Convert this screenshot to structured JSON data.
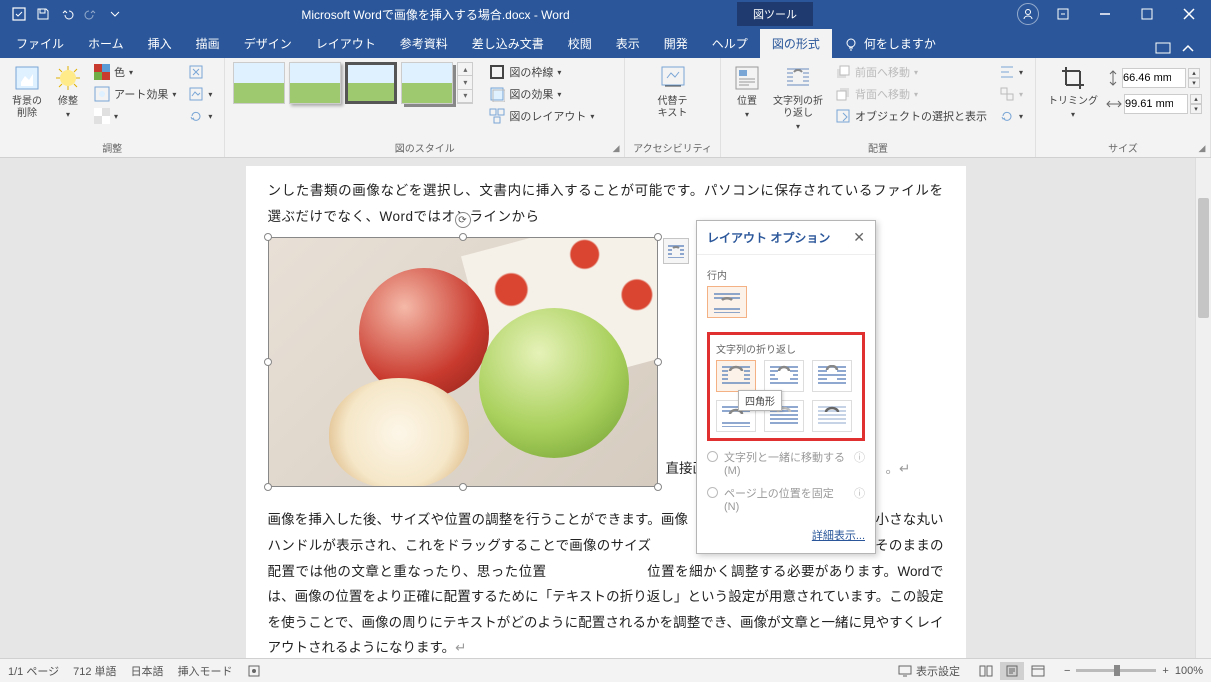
{
  "titlebar": {
    "doc_title": "Microsoft Wordで画像を挿入する場合.docx - Word",
    "context_tab": "図ツール"
  },
  "tabs": {
    "file": "ファイル",
    "home": "ホーム",
    "insert": "挿入",
    "draw": "描画",
    "design": "デザイン",
    "layout": "レイアウト",
    "references": "参考資料",
    "mailings": "差し込み文書",
    "review": "校閲",
    "view": "表示",
    "developer": "開発",
    "help": "ヘルプ",
    "format": "図の形式",
    "tell_me": "何をしますか"
  },
  "ribbon": {
    "remove_bg": "背景の\n削除",
    "corrections": "修整",
    "color": "色",
    "artistic": "アート効果",
    "adjust_group": "調整",
    "border": "図の枠線",
    "effects": "図の効果",
    "layout_pic": "図のレイアウト",
    "styles_group": "図のスタイル",
    "alt_text": "代替テ\nキスト",
    "access_group": "アクセシビリティ",
    "position": "位置",
    "wrap_text": "文字列の折\nり返し",
    "bring_fwd": "前面へ移動",
    "send_back": "背面へ移動",
    "selection": "オブジェクトの選択と表示",
    "arrange_group": "配置",
    "crop": "トリミング",
    "height": "66.46 mm",
    "width": "99.61 mm",
    "size_group": "サイズ"
  },
  "doc": {
    "para1": "ンした書類の画像などを選択し、文書内に挿入することが可能です。パソコンに保存されているファイルを選ぶだけでなく、Wordではオンラインから",
    "inline_end": "直接画像",
    "para2": "画像を挿入した後、サイズや位置の調整を行うことができます。画像",
    "para2b": "りに小さな丸いハンドルが表示され、これをドラッグすることで画像のサイズ",
    "para2c": "た、挿入した画像はそのままの配置では他の文章と重なったり、思った位置",
    "para2d": "位置を細かく調整する必要があります。Wordでは、画像の位置をより正確に配置するために「テキストの折り返し」という設定が用意されています。この設定を使うことで、画像の周りにテキストがどのように配置されるかを調整でき、画像が文章と一緒に見やすくレイアウトされるようになります。"
  },
  "layout_popup": {
    "title": "レイアウト オプション",
    "inline_label": "行内",
    "wrap_label": "文字列の折り返し",
    "square_tooltip": "四角形",
    "move_with_text": "文字列と一緒に移動する(M)",
    "fix_position": "ページ上の位置を固定(N)",
    "detail": "詳細表示..."
  },
  "statusbar": {
    "page": "1/1 ページ",
    "words": "712 単語",
    "lang": "日本語",
    "mode": "挿入モード",
    "display": "表示設定",
    "zoom": "100%"
  }
}
